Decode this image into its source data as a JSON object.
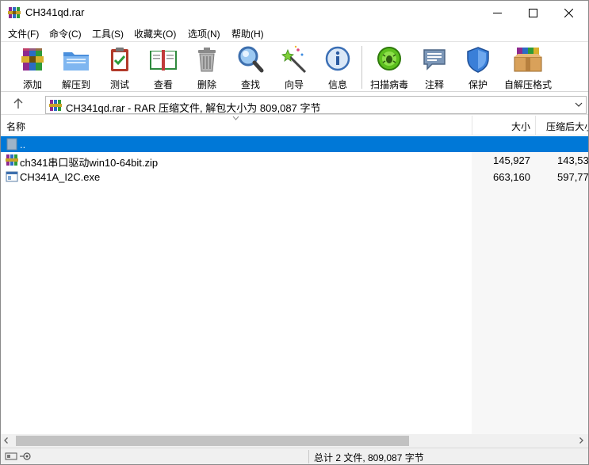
{
  "window": {
    "title": "CH341qd.rar"
  },
  "menu": [
    {
      "label": "文件(F)"
    },
    {
      "label": "命令(C)"
    },
    {
      "label": "工具(S)"
    },
    {
      "label": "收藏夹(O)"
    },
    {
      "label": "选项(N)"
    },
    {
      "label": "帮助(H)"
    }
  ],
  "toolbar": [
    {
      "label": "添加",
      "icon": "add-archive-icon"
    },
    {
      "label": "解压到",
      "icon": "extract-folder-icon"
    },
    {
      "label": "测试",
      "icon": "test-clipboard-icon"
    },
    {
      "label": "查看",
      "icon": "view-book-icon"
    },
    {
      "label": "删除",
      "icon": "trash-can-icon"
    },
    {
      "label": "查找",
      "icon": "magnifier-icon"
    },
    {
      "label": "向导",
      "icon": "magic-wand-icon"
    },
    {
      "label": "信息",
      "icon": "info-icon"
    },
    {
      "label": "扫描病毒",
      "icon": "virus-scan-icon"
    },
    {
      "label": "注释",
      "icon": "comment-icon"
    },
    {
      "label": "保护",
      "icon": "shield-icon"
    },
    {
      "label": "自解压格式",
      "icon": "sfx-box-icon"
    }
  ],
  "path": {
    "text": "CH341qd.rar - RAR 压缩文件, 解包大小为 809,087 字节"
  },
  "columns": {
    "name": "名称",
    "size": "大小",
    "packed": "压缩后大小"
  },
  "rows": [
    {
      "name": "..",
      "size": "",
      "packed": "",
      "selected": true,
      "icon": "parent-folder-icon"
    },
    {
      "name": "ch341串口驱动win10-64bit.zip",
      "size": "145,927",
      "packed": "143,53",
      "selected": false,
      "icon": "zip-archive-icon"
    },
    {
      "name": "CH341A_I2C.exe",
      "size": "663,160",
      "packed": "597,77",
      "selected": false,
      "icon": "exe-file-icon"
    }
  ],
  "status": {
    "text": "总计 2 文件, 809,087 字节"
  },
  "colors": {
    "selection": "#0078d7",
    "scrollbar_thumb": "#c2c2c2"
  }
}
